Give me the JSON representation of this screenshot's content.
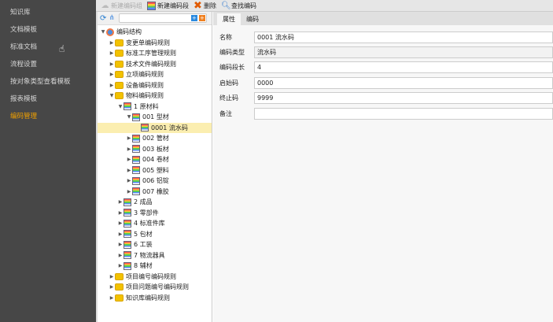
{
  "sidebar": {
    "items": [
      "知识库",
      "文档模板",
      "标准文档",
      "流程设置",
      "按对象类型查看模板",
      "报表模板",
      "编码管理"
    ],
    "active_index": 6
  },
  "toolbar": {
    "new_group": "新建编码组",
    "new_segment": "新建编码段",
    "delete": "删除",
    "find": "查找编码"
  },
  "tree": {
    "search_placeholder": "",
    "items": [
      {
        "label": "编码结构",
        "level": 0,
        "type": "root",
        "expanded": true
      },
      {
        "label": "变更单编码规则",
        "level": 1,
        "type": "folder"
      },
      {
        "label": "标准工序管理规则",
        "level": 1,
        "type": "folder"
      },
      {
        "label": "技术文件编码规则",
        "level": 1,
        "type": "folder"
      },
      {
        "label": "立项编码规则",
        "level": 1,
        "type": "folder"
      },
      {
        "label": "设备编码规则",
        "level": 1,
        "type": "folder"
      },
      {
        "label": "物料编码规则",
        "level": 1,
        "type": "folder",
        "expanded": true
      },
      {
        "label": "1 原材料",
        "level": 2,
        "type": "doc",
        "expanded": true
      },
      {
        "label": "001 型材",
        "level": 3,
        "type": "doc",
        "expanded": true
      },
      {
        "label": "0001 流水码",
        "level": 4,
        "type": "doc",
        "leaf": true,
        "selected": true
      },
      {
        "label": "002 管材",
        "level": 3,
        "type": "doc"
      },
      {
        "label": "003 板材",
        "level": 3,
        "type": "doc"
      },
      {
        "label": "004 卷材",
        "level": 3,
        "type": "doc"
      },
      {
        "label": "005 塑料",
        "level": 3,
        "type": "doc"
      },
      {
        "label": "006 铝锭",
        "level": 3,
        "type": "doc"
      },
      {
        "label": "007 橡胶",
        "level": 3,
        "type": "doc"
      },
      {
        "label": "2 成品",
        "level": 2,
        "type": "doc"
      },
      {
        "label": "3 零部件",
        "level": 2,
        "type": "doc"
      },
      {
        "label": "4 标准件库",
        "level": 2,
        "type": "doc"
      },
      {
        "label": "5 包材",
        "level": 2,
        "type": "doc"
      },
      {
        "label": "6 工装",
        "level": 2,
        "type": "doc"
      },
      {
        "label": "7 物流器具",
        "level": 2,
        "type": "doc"
      },
      {
        "label": "8 辅材",
        "level": 2,
        "type": "doc"
      },
      {
        "label": "项目编号编码规则",
        "level": 1,
        "type": "folder"
      },
      {
        "label": "项目问题编号编码规则",
        "level": 1,
        "type": "folder"
      },
      {
        "label": "知识库编码规则",
        "level": 1,
        "type": "folder"
      }
    ]
  },
  "tabs": [
    "属性",
    "编码"
  ],
  "form": [
    {
      "label": "名称",
      "value": "0001 流水码"
    },
    {
      "label": "编码类型",
      "value": "流水码",
      "readonly": true
    },
    {
      "label": "编码段长",
      "value": "4"
    },
    {
      "label": "启始码",
      "value": "0000"
    },
    {
      "label": "终止码",
      "value": "9999"
    },
    {
      "label": "备注",
      "value": ""
    }
  ]
}
